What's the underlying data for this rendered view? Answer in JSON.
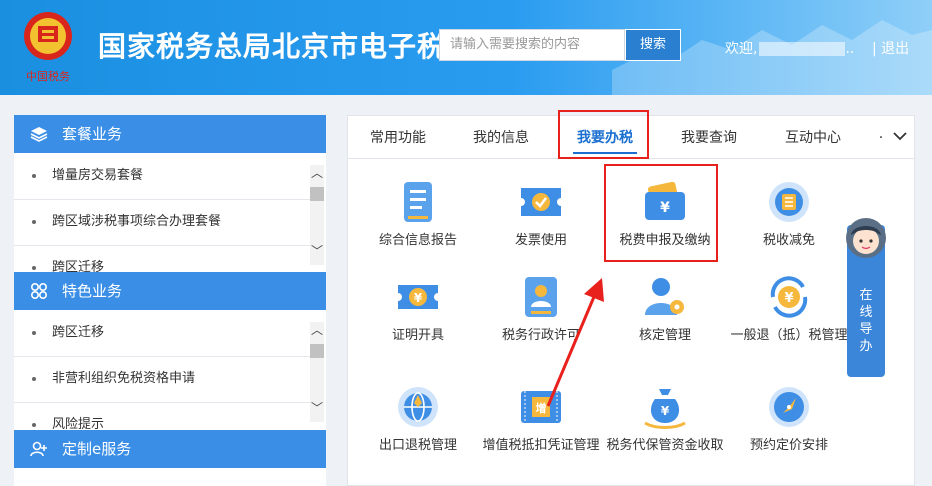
{
  "header": {
    "site_title": "国家税务总局北京市电子税务局",
    "search_placeholder": "请输入需要搜索的内容",
    "search_button": "搜索",
    "welcome": "欢迎,",
    "welcome_suffix": "..",
    "separator": "|",
    "logout": "退出"
  },
  "sidebar": {
    "sections": [
      {
        "title": "套餐业务",
        "items": [
          "增量房交易套餐",
          "跨区域涉税事项综合办理套餐",
          "跨区迁移"
        ]
      },
      {
        "title": "特色业务",
        "items": [
          "跨区迁移",
          "非营利组织免税资格申请",
          "风险提示"
        ]
      },
      {
        "title": "定制e服务",
        "items": []
      }
    ]
  },
  "tabs": [
    {
      "label": "常用功能",
      "active": false
    },
    {
      "label": "我的信息",
      "active": false
    },
    {
      "label": "我要办税",
      "active": true
    },
    {
      "label": "我要查询",
      "active": false
    },
    {
      "label": "互动中心",
      "active": false
    },
    {
      "label": "·",
      "active": false
    }
  ],
  "tiles": [
    {
      "label": "综合信息报告",
      "icon": "report-icon"
    },
    {
      "label": "发票使用",
      "icon": "invoice-icon"
    },
    {
      "label": "税费申报及缴纳",
      "icon": "wallet-yuan-icon"
    },
    {
      "label": "税收减免",
      "icon": "coin-stack-icon"
    },
    {
      "label": "证明开具",
      "icon": "certificate-icon"
    },
    {
      "label": "税务行政许可",
      "icon": "license-icon"
    },
    {
      "label": "核定管理",
      "icon": "user-gear-icon"
    },
    {
      "label": "一般退（抵）税管理",
      "icon": "refund-icon"
    },
    {
      "label": "出口退税管理",
      "icon": "globe-icon"
    },
    {
      "label": "增值税抵扣凭证管理",
      "icon": "vat-ticket-icon"
    },
    {
      "label": "税务代保管资金收取",
      "icon": "money-bag-icon"
    },
    {
      "label": "预约定价安排",
      "icon": "compass-icon"
    }
  ],
  "online_guide": {
    "text": [
      "在",
      "线",
      "导",
      "办"
    ]
  },
  "colors": {
    "brand_blue": "#2a9cf0",
    "active_tab": "#1a6fd0",
    "highlight_red": "#e8211d",
    "section_blue": "#3a8ee6"
  }
}
